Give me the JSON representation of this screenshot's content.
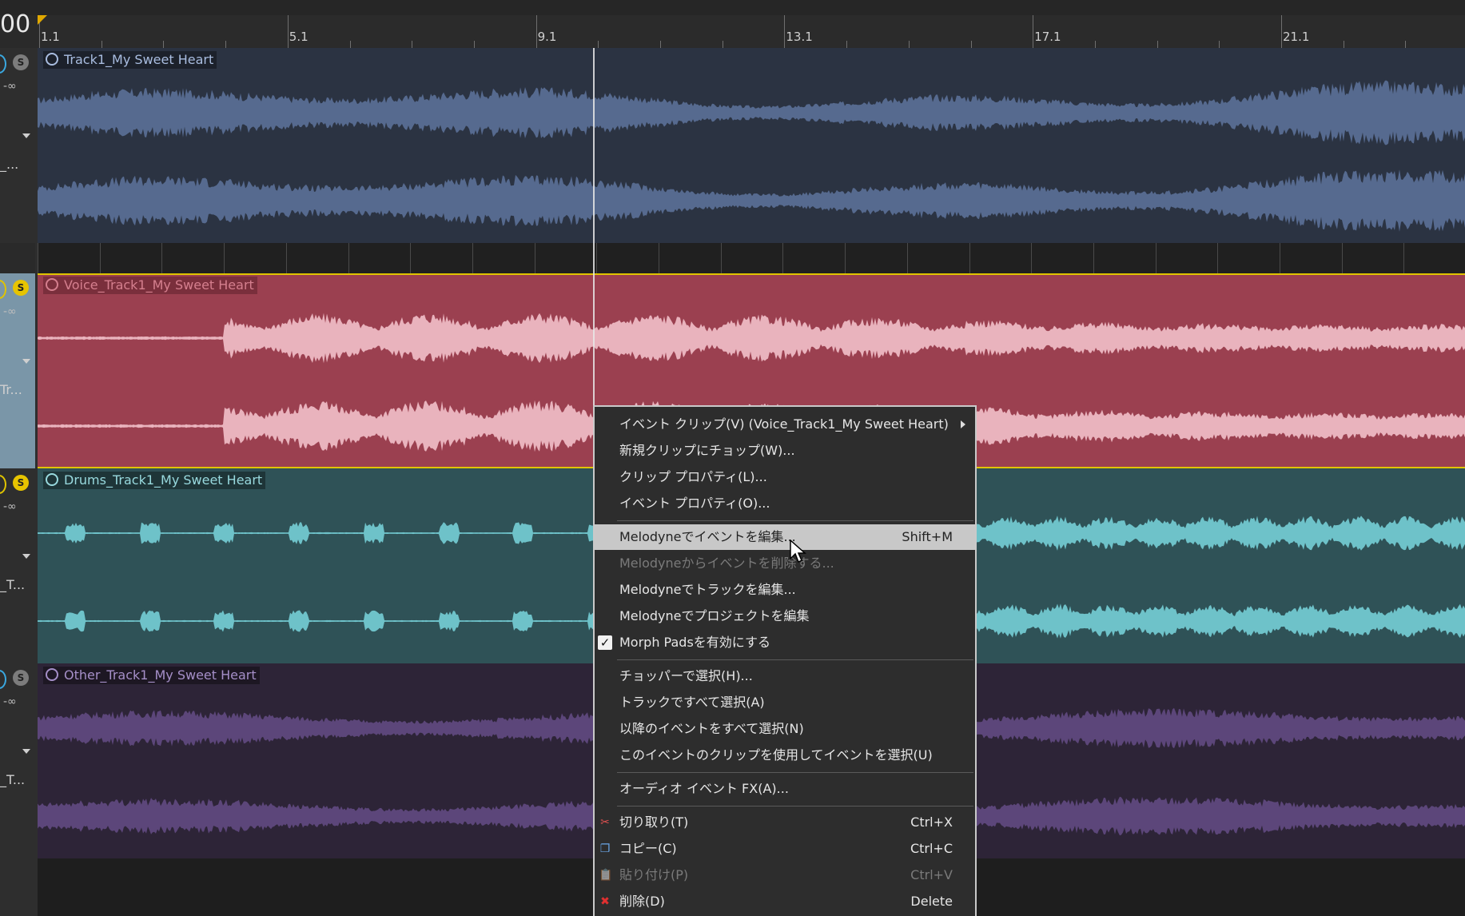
{
  "time_readout": "00",
  "ruler": {
    "labels": [
      "1.1",
      "5.1",
      "9.1",
      "13.1",
      "17.1",
      "21.1"
    ]
  },
  "headers": [
    {
      "level": "-∞",
      "name": "_..."
    },
    {
      "level": "-∞",
      "name": "Tr..."
    },
    {
      "level": "-∞",
      "name": "_T..."
    },
    {
      "level": "-∞",
      "name": "_T..."
    }
  ],
  "tracks": [
    {
      "label": "Track1_My Sweet Heart",
      "bg": "#2b3342",
      "wave": "#566a8f",
      "label_color": "#a9bde0"
    },
    {
      "label": "Voice_Track1_My Sweet Heart",
      "bg": "#9b4050",
      "wave": "#e9b3bd",
      "label_color": "#d57f8e",
      "selected": true
    },
    {
      "label": "Drums_Track1_My Sweet Heart",
      "bg": "#2f5257",
      "wave": "#6ec2c9",
      "label_color": "#98d9de"
    },
    {
      "label": "Other_Track1_My Sweet Heart",
      "bg": "#2d2437",
      "wave": "#5c467a",
      "label_color": "#a58fc8"
    }
  ],
  "context_menu": {
    "items": [
      {
        "label": "イベント クリップ(V) (Voice_Track1_My Sweet Heart)",
        "submenu": true
      },
      {
        "label": "新規クリップにチョップ(W)..."
      },
      {
        "label": "クリップ プロパティ(L)..."
      },
      {
        "label": "イベント プロパティ(O)..."
      },
      {
        "separator": true
      },
      {
        "label": "Melodyneでイベントを編集...",
        "shortcut": "Shift+M",
        "hover": true
      },
      {
        "label": "Melodyneからイベントを削除する...",
        "disabled": true
      },
      {
        "label": "Melodyneでトラックを編集..."
      },
      {
        "label": "Melodyneでプロジェクトを編集"
      },
      {
        "label": "Morph Padsを有効にする",
        "checked": true
      },
      {
        "separator": true
      },
      {
        "label": "チョッパーで選択(H)..."
      },
      {
        "label": "トラックですべて選択(A)"
      },
      {
        "label": "以降のイベントをすべて選択(N)"
      },
      {
        "label": "このイベントのクリップを使用してイベントを選択(U)"
      },
      {
        "separator": true
      },
      {
        "label": "オーディオ イベント FX(A)..."
      },
      {
        "separator": true
      },
      {
        "label": "切り取り(T)",
        "shortcut": "Ctrl+X",
        "icon": "scissors-icon"
      },
      {
        "label": "コピー(C)",
        "shortcut": "Ctrl+C",
        "icon": "copy-icon"
      },
      {
        "label": "貼り付け(P)",
        "shortcut": "Ctrl+V",
        "icon": "paste-icon",
        "disabled": true
      },
      {
        "label": "削除(D)",
        "shortcut": "Delete",
        "icon": "delete-icon"
      }
    ]
  },
  "colors": {
    "accent": "#e0c400",
    "menu_hover": "#c8c8c8"
  }
}
